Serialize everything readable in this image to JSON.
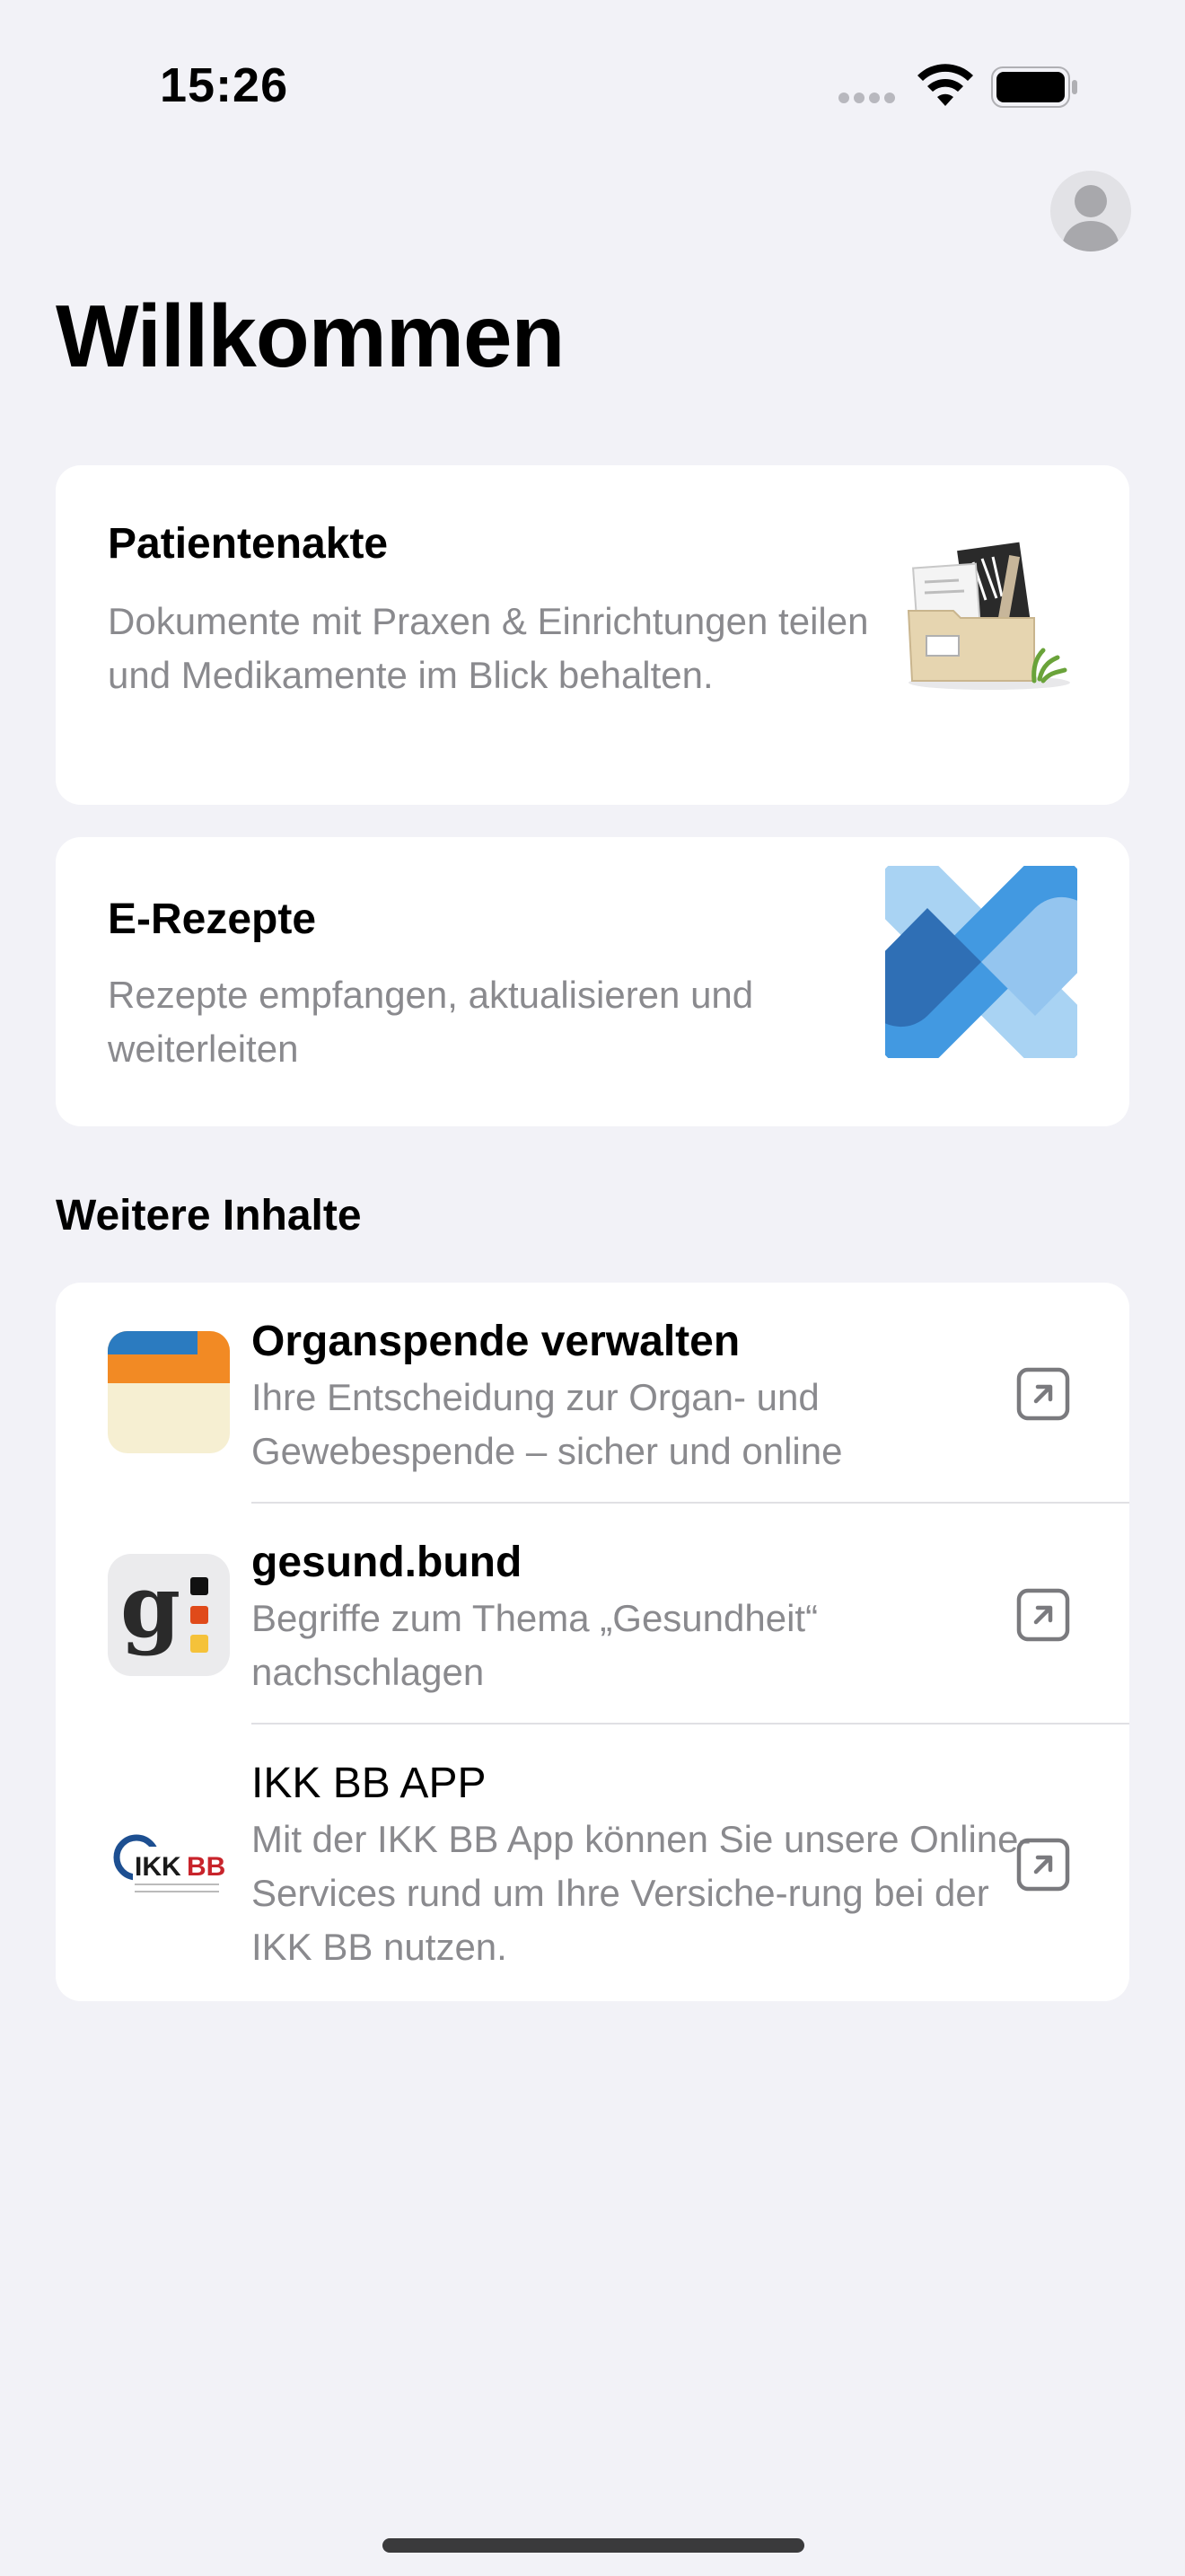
{
  "status_bar": {
    "time": "15:26"
  },
  "header": {
    "title": "Willkommen"
  },
  "cards": [
    {
      "title": "Patientenakte",
      "description": "Dokumente mit Praxen & Einrichtungen teilen und Medikamente im Blick behalten.",
      "icon": "folder-documents-illustration"
    },
    {
      "title": "E-Rezepte",
      "description": "Rezepte empfangen, aktualisieren und weiterleiten",
      "icon": "prescription-cross-icon"
    }
  ],
  "section": {
    "title": "Weitere Inhalte",
    "items": [
      {
        "title": "Organspende verwalten",
        "subtitle": "Ihre Entscheidung zur Organ- und Gewebespende – sicher und online",
        "icon": "organspende-app-icon"
      },
      {
        "title": "gesund.bund",
        "subtitle": "Begriffe zum Thema „Gesundheit“ nachschlagen",
        "icon": "gesund-bund-app-icon"
      },
      {
        "title": "IKK BB APP",
        "subtitle": "Mit der IKK BB App können Sie unsere Online-Services rund um Ihre Versiche-rung bei der IKK BB nutzen.",
        "icon": "ikk-bb-app-icon",
        "logo_text": "IKK BB"
      }
    ]
  },
  "colors": {
    "background": "#f2f2f7",
    "card": "#ffffff",
    "secondary_text": "#8a8a8e",
    "accent_blue": "#3b8fe0"
  }
}
